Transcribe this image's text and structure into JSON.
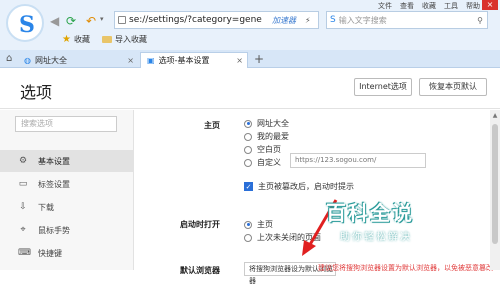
{
  "browser": {
    "menu": [
      "文件",
      "查看",
      "收藏",
      "工具",
      "帮助"
    ],
    "address_url": "se://settings/?category=gene",
    "accelerator_label": "加速器",
    "search_placeholder": "输入文字搜索",
    "bookmarks": [
      "收藏",
      "导入收藏"
    ],
    "tabs": [
      "网址大全",
      "选项-基本设置"
    ]
  },
  "page": {
    "title": "选项",
    "btn_internet": "Internet选项",
    "btn_reset": "恢复本页默认"
  },
  "sidebar": {
    "search_placeholder": "搜索选项",
    "items": [
      {
        "label": "基本设置",
        "icon": "gear-icon",
        "active": true
      },
      {
        "label": "标签设置",
        "icon": "tab-icon",
        "active": false
      },
      {
        "label": "下载",
        "icon": "download-icon",
        "active": false
      },
      {
        "label": "鼠标手势",
        "icon": "mouse-icon",
        "active": false
      },
      {
        "label": "快捷键",
        "icon": "keyboard-icon",
        "active": false
      }
    ]
  },
  "homepage": {
    "label": "主页",
    "options": [
      "网址大全",
      "我的最爱",
      "空白页",
      "自定义"
    ],
    "custom_url": "https://123.sogou.com/",
    "checkbox_label": "主页被篡改后，启动时提示"
  },
  "startup": {
    "label": "启动时打开",
    "options": [
      "主页",
      "上次未关闭的页面"
    ]
  },
  "bottom": {
    "label": "默认浏览器",
    "select_value": "将搜狗浏览器设为默认浏览器",
    "note": "建议您将搜狗浏览器设置为默认浏览器，以免被恶意篡改"
  },
  "watermark": {
    "title": "百科全说",
    "subtitle": "助你轻松解决"
  },
  "colors": {
    "accent": "#2a6fd8",
    "arrow": "#e02020",
    "watermark": "#2b9b9a"
  }
}
